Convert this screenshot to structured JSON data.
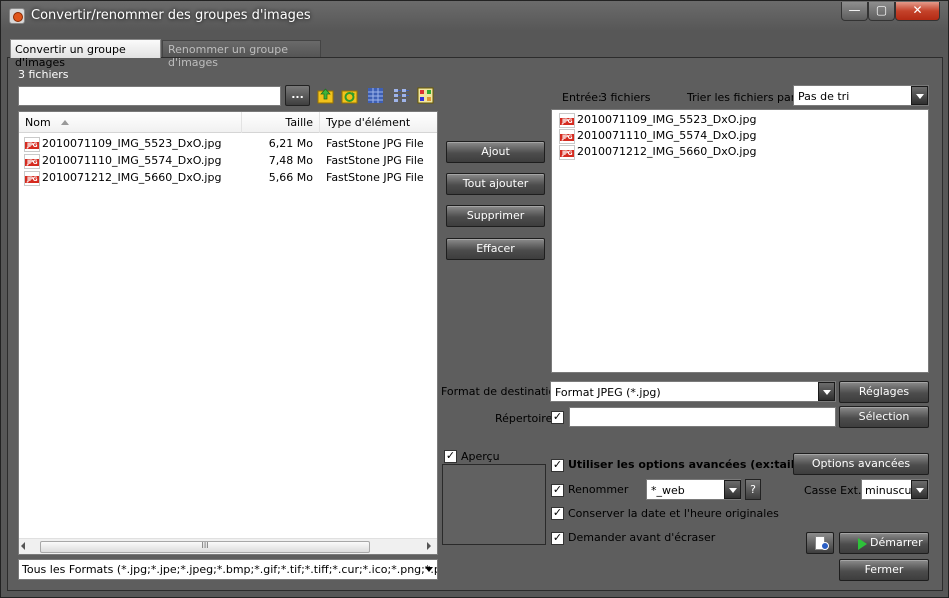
{
  "window": {
    "title": "Convertir/renommer des groupes d'images",
    "min_glyph": "—",
    "max_glyph": "▢",
    "close_glyph": "✕"
  },
  "tabs": [
    {
      "label": "Convertir un groupe d'images",
      "active": true
    },
    {
      "label": "Renommer un groupe d'images",
      "active": false
    }
  ],
  "left": {
    "file_count": "3 fichiers",
    "path_value": "",
    "browse_label": "...",
    "columns": {
      "name": "Nom",
      "size": "Taille",
      "type": "Type d'élément"
    },
    "files": [
      {
        "name": "2010071109_IMG_5523_DxO.jpg",
        "size": "6,21 Mo",
        "type": "FastStone JPG File"
      },
      {
        "name": "2010071110_IMG_5574_DxO.jpg",
        "size": "7,48 Mo",
        "type": "FastStone JPG File"
      },
      {
        "name": "2010071212_IMG_5660_DxO.jpg",
        "size": "5,66 Mo",
        "type": "FastStone JPG File"
      }
    ],
    "scroll_grip": "III",
    "format_filter": "Tous les Formats (*.jpg;*.jpe;*.jpeg;*.bmp;*.gif;*.tif;*.tiff;*.cur;*.ico;*.png;*.p"
  },
  "middle": {
    "add": "Ajout",
    "add_all": "Tout ajouter",
    "remove": "Supprimer",
    "clear": "Effacer"
  },
  "right": {
    "input_label": "Entrée:",
    "input_count": "3 fichiers",
    "sort_label": "Trier les fichiers par:",
    "sort_value": "Pas de tri",
    "input_files": [
      "2010071109_IMG_5523_DxO.jpg",
      "2010071110_IMG_5574_DxO.jpg",
      "2010071212_IMG_5660_DxO.jpg"
    ],
    "dest_label": "Format de destination:",
    "dest_value": "Format JPEG (*.jpg)",
    "settings_btn": "Réglages",
    "dir_label": "Répertoire:",
    "dir_checked": true,
    "dir_value": "",
    "select_btn": "Sélection",
    "preview_label": "Aperçu",
    "preview_checked": true,
    "adv_label": "Utiliser les options avancées (ex:taille...)",
    "adv_checked": true,
    "adv_btn": "Options avancées",
    "rename_label": "Renommer",
    "rename_checked": true,
    "rename_value": "*_web",
    "help_label": "?",
    "case_label": "Casse Ext.:",
    "case_value": "minuscule",
    "keep_date_label": "Conserver la date et l'heure originales",
    "keep_date_checked": true,
    "ask_label": "Demander avant d'écraser",
    "ask_checked": true,
    "start_btn": "Démarrer",
    "close_btn": "Fermer"
  },
  "icons": {
    "app": "app-icon",
    "checkmark": "✓",
    "jpg_badge": "JPG"
  }
}
